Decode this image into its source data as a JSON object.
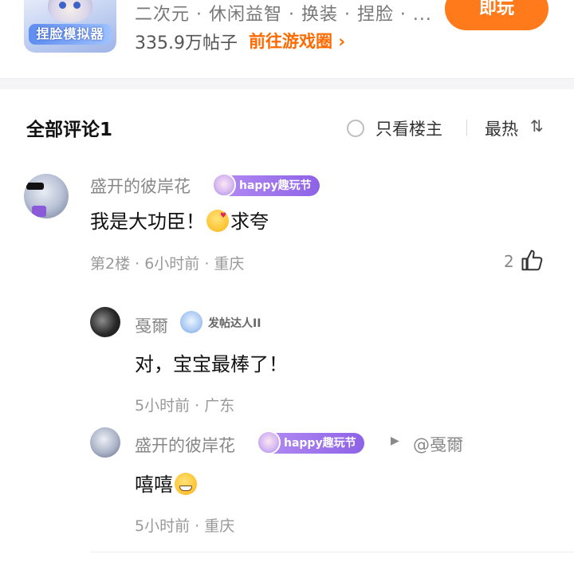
{
  "game": {
    "icon_text": "捏脸模拟器",
    "tags": "二次元 · 休闲益智 · 换装 · 捏脸 · ...",
    "posts": "335.9万帖子",
    "link_label": "前往游戏圈",
    "link_chevron": "›",
    "play_label": "即玩"
  },
  "comments_header": {
    "title": "全部评论1",
    "only_host_label": "只看楼主",
    "sort_label": "最热",
    "sort_icon": "⇅"
  },
  "comments": [
    {
      "user": "盛开的彼岸花",
      "badge": "happy趣玩节",
      "content_before": "我是大功臣！",
      "content_after": "求夸",
      "emoji": "kiss-face",
      "meta": "第2楼 · 6小时前 · 重庆",
      "likes": "2",
      "replies": [
        {
          "user": "戞爾",
          "badge": "发帖达人II",
          "content": "对，宝宝最棒了！",
          "meta": "5小时前 · 广东"
        },
        {
          "user": "盛开的彼岸花",
          "badge": "happy趣玩节",
          "reply_to": "@戞爾",
          "content": "嘻嘻",
          "emoji": "grin-face",
          "meta": "5小时前 · 重庆"
        }
      ]
    }
  ],
  "colors": {
    "accent": "#ff6a00",
    "play_button": "#ff7a1a",
    "badge_purple": "#8e62e6",
    "muted_text": "#999999"
  }
}
